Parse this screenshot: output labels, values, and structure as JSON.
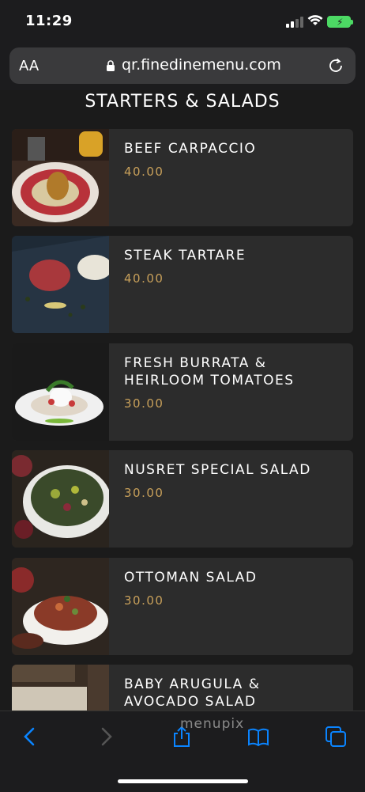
{
  "status": {
    "time": "11:29"
  },
  "browser": {
    "text_size_label": "AA",
    "url": "qr.finedinemenu.com"
  },
  "page": {
    "heading": "STARTERS & SALADS",
    "items": [
      {
        "name": "BEEF CARPACCIO",
        "price": "40.00"
      },
      {
        "name": "STEAK TARTARE",
        "price": "40.00"
      },
      {
        "name": "FRESH BURRATA & HEIRLOOM TOMATOES",
        "price": "30.00"
      },
      {
        "name": "NUSRET SPECIAL SALAD",
        "price": "30.00"
      },
      {
        "name": "OTTOMAN SALAD",
        "price": "30.00"
      },
      {
        "name": "BABY ARUGULA & AVOCADO SALAD",
        "price": ""
      }
    ]
  },
  "watermark": "menupix",
  "colors": {
    "price": "#c8a05a",
    "card": "#2c2c2c",
    "accent": "#0a84ff"
  }
}
